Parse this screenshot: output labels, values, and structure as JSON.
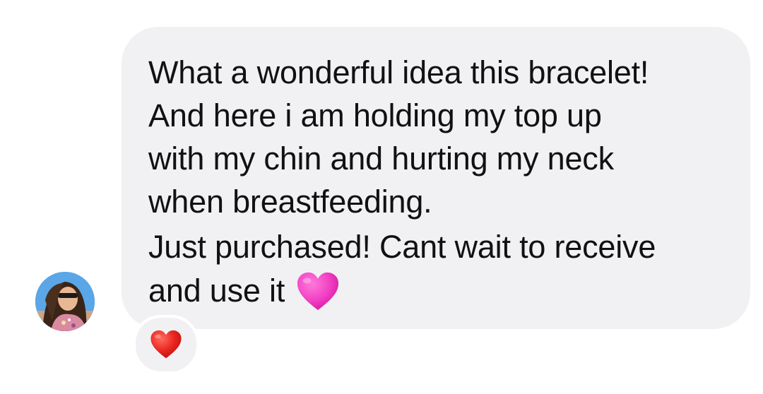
{
  "message": {
    "lines": [
      "What a wonderful idea this bracelet!",
      "And here i am holding my top up",
      "with my chin and hurting my neck",
      "when breastfeeding.",
      "Just purchased! Cant wait to receive",
      "and use it"
    ],
    "trailing_emoji": "pink-heart-icon",
    "bubble_color": "#f1f1f4",
    "text_color": "#111111"
  },
  "reaction": {
    "emoji": "red-heart-icon",
    "color": "#e8231f"
  },
  "sender": {
    "avatar": "avatar-photo"
  }
}
